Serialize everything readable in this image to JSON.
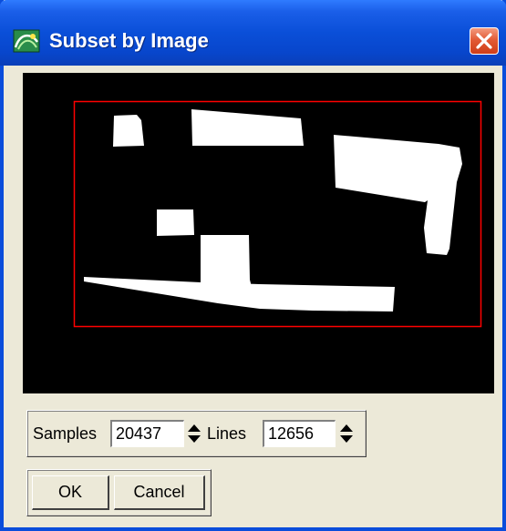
{
  "window": {
    "title": "Subset by Image"
  },
  "icons": {
    "app": "envi-app-icon",
    "close": "close-icon",
    "spin": "spin-updown-icon"
  },
  "colors": {
    "titlebar": "#0a4fd8",
    "close_button": "#e25b36",
    "subset_box": "#ff0000",
    "preview_bg": "#000000",
    "preview_fg": "#ffffff",
    "dialog_bg": "#ece9d8"
  },
  "dimensions": {
    "samples_label": "Samples",
    "samples_value": "20437",
    "lines_label": "Lines",
    "lines_value": "12656"
  },
  "buttons": {
    "ok_label": "OK",
    "cancel_label": "Cancel"
  }
}
